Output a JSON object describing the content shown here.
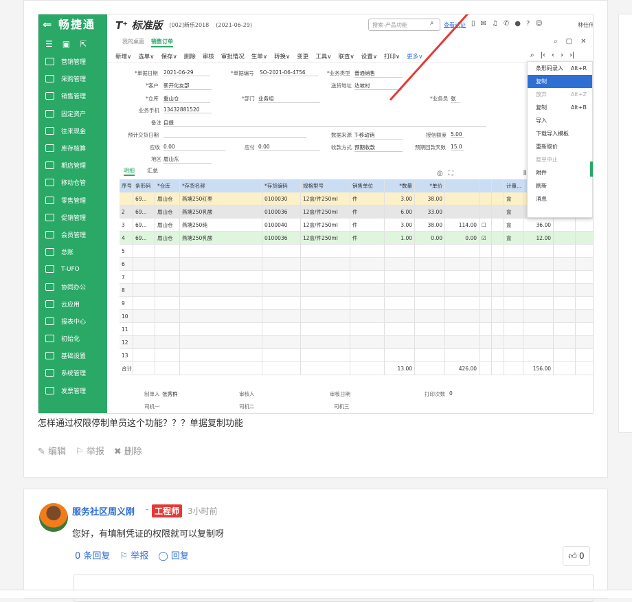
{
  "post": {
    "note": "怎样通过权限停制单员这个功能？？？单据复制功能",
    "actions": [
      "编辑",
      "举报",
      "删除"
    ]
  },
  "app": {
    "logo": "⇐ 畅捷通",
    "brand": "T⁺ 标准版",
    "account": "[002]新乐2018",
    "date": "(2021-06-29)",
    "search_placeholder": "搜索-产品功能",
    "cert_link": "查看认证",
    "user": "林仕伟",
    "tabs": [
      "我的桌面",
      "销售订单"
    ],
    "toolbar": [
      "新增∨",
      "选单∨",
      "保存∨",
      "删除",
      "审核",
      "审批情况",
      "生单∨",
      "转换∨",
      "变更",
      "工具∨",
      "联查∨",
      "设置∨",
      "打印∨",
      "更多∨"
    ],
    "sidebar": [
      "营销管理",
      "采购管理",
      "销售管理",
      "固定资产",
      "往来现金",
      "库存核算",
      "期店管理",
      "移动仓管",
      "零售管理",
      "促销管理",
      "会员管理",
      "总账",
      "T-UFO",
      "协同办公",
      "云应用",
      "报表中心",
      "初始化",
      "基础设置",
      "系统管理",
      "发票管理"
    ],
    "form": {
      "date_label": "*单据日期",
      "date": "2021-06-29",
      "no_label": "*单据编号",
      "no": "SO-2021-06-4756",
      "biz_label": "*业务类型",
      "biz": "普通销售",
      "cust_label": "*客户",
      "cust": "新开化友部",
      "ship_label": "送货地址",
      "ship": "达坡村",
      "wh_label": "*仓库",
      "wh": "重山仓",
      "dept_label": "*部门",
      "dept": "业务组",
      "staff_label": "*业务员",
      "staff": "张",
      "phone_label": "业务手机",
      "phone": "13432881520",
      "remark_label": "备注",
      "remark": "自提",
      "deliv_label": "预计交货日期",
      "src_label": "数据来源",
      "src": "T-移动销",
      "credit_label": "授信额度",
      "credit": "5.00",
      "recv_label": "应收",
      "recv": "0.00",
      "paid_label": "应付",
      "paid": "0.00",
      "pay_label": "收款方式",
      "pay": "预期收款",
      "days_label": "预期回款天数",
      "days": "15.0",
      "area_label": "地区",
      "area": "眉山东"
    },
    "subtabs": [
      "明细",
      "汇总"
    ],
    "grid": {
      "headers": [
        "序号",
        "条形码",
        "*仓库",
        "*存货名称",
        "*存货编码",
        "规格型号",
        "销售单位",
        "*数量",
        "*单价",
        "",
        "",
        "",
        "计量...",
        "数量2",
        "可用量"
      ],
      "rows": [
        [
          "",
          "69...",
          "眉山仓",
          "燕塘250红枣",
          "0100030",
          "12盒/件250ml",
          "件",
          "3.00",
          "38.00",
          "",
          "",
          "",
          "盒",
          "36.00",
          ""
        ],
        [
          "2",
          "69...",
          "眉山仓",
          "燕塘250乳酸",
          "0100036",
          "12盒/件250ml",
          "件",
          "6.00",
          "33.00",
          "",
          "",
          "",
          "盒",
          "72.00",
          ""
        ],
        [
          "3",
          "69...",
          "眉山仓",
          "燕塘250纯",
          "0100040",
          "12盒/件250ml",
          "件",
          "3.00",
          "38.00",
          "114.00",
          "☐",
          "",
          "盒",
          "36.00",
          ""
        ],
        [
          "4",
          "69...",
          "眉山仓",
          "燕塘250乳酸",
          "0100036",
          "12盒/件250ml",
          "件",
          "1.00",
          "0.00",
          "0.00",
          "☑",
          "",
          "盒",
          "12.00",
          ""
        ]
      ],
      "empty_rows": [
        "5",
        "6",
        "7",
        "8",
        "9",
        "10",
        "11",
        "12",
        "13"
      ],
      "total_label": "合计",
      "totals": {
        "qty": "13.00",
        "amount": "426.00",
        "qty2": "156.00"
      }
    },
    "footer": {
      "maker_label": "制单人",
      "maker": "张秀群",
      "auditor_label": "审核人",
      "audit_date_label": "审核日期",
      "print_label": "打印次数",
      "print": "0",
      "driver1": "司机一",
      "driver2": "司机二",
      "driver3": "司机三"
    },
    "context_menu": [
      {
        "label": "条形码录入",
        "key": "Alt+R"
      },
      {
        "label": "复制",
        "key": ""
      },
      {
        "label": "放弃",
        "key": "Alt+Z"
      },
      {
        "label": "复制",
        "key": "Alt+B"
      },
      {
        "label": "导入",
        "key": ""
      },
      {
        "label": "下载导入模板",
        "key": ""
      },
      {
        "label": "重新取价",
        "key": ""
      },
      {
        "label": "整单中止",
        "key": ""
      },
      {
        "label": "附件",
        "key": ""
      },
      {
        "label": "刷新",
        "key": ""
      },
      {
        "label": "消息",
        "key": ""
      }
    ]
  },
  "reply": {
    "author": "服务社区周义刚",
    "badge": "工程师",
    "time": "3小时前",
    "text": "您好，有填制凭证的权限就可以复制呀",
    "actions": [
      "0 条回复",
      "举报",
      "回复"
    ],
    "likes": "0"
  },
  "colors": {
    "accent": "#2aa866",
    "link": "#2e6fd4",
    "red": "#e53935"
  }
}
